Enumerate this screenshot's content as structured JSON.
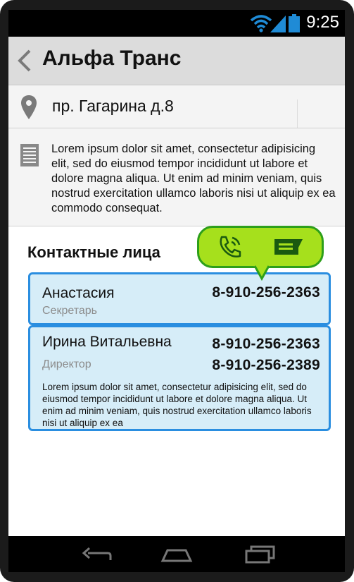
{
  "status": {
    "time": "9:25"
  },
  "header": {
    "title": "Альфа Транс"
  },
  "company": {
    "address": "пр. Гагарина д.8",
    "description": "Lorem ipsum dolor sit amet, consectetur adipisicing elit, sed do eiusmod tempor incididunt ut labore et dolore magna aliqua. Ut enim ad minim veniam, quis nostrud exercitation ullamco laboris nisi ut aliquip ex ea commodo consequat."
  },
  "contacts": {
    "section_title": "Контактные лица",
    "items": [
      {
        "name": "Анастасия",
        "role": "Секретарь",
        "phones": [
          "8-910-256-2363"
        ]
      },
      {
        "name": "Ирина Витальевна",
        "role": "Директор",
        "phones": [
          "8-910-256-2363",
          "8-910-256-2389"
        ],
        "note": "Lorem ipsum dolor sit amet, consectetur adipisicing elit, sed do eiusmod tempor incididunt ut labore et dolore magna aliqua. Ut enim ad minim veniam, quis nostrud exercitation ullamco laboris nisi ut aliquip ex ea"
      }
    ]
  },
  "popup": {
    "actions": [
      "phone-icon",
      "message-icon"
    ],
    "color": "#a6e01c",
    "border_color": "#2d9f1a"
  },
  "colors": {
    "card_bg": "#d6edf8",
    "card_border": "#2a8ee0",
    "titlebar_bg": "#dcdcdc"
  },
  "icons": {
    "status": [
      "wifi-icon",
      "signal-icon",
      "battery-icon"
    ],
    "navigation": [
      "nav-back-icon",
      "nav-home-icon",
      "nav-recent-apps-icon"
    ]
  }
}
